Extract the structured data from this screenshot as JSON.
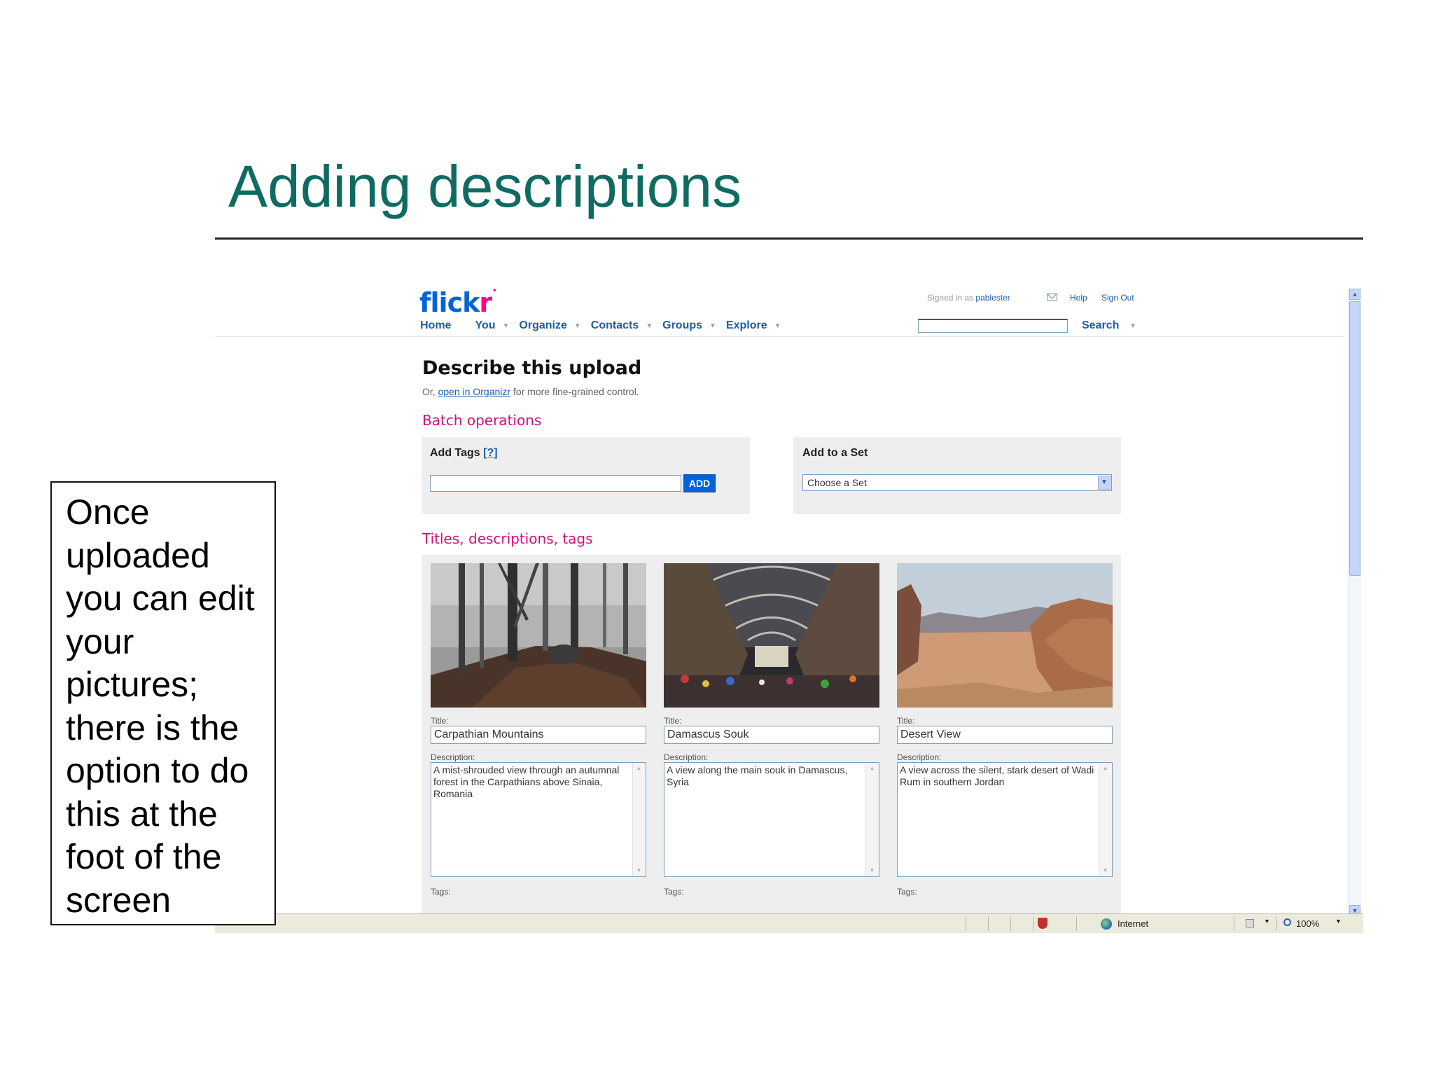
{
  "slide": {
    "title": "Adding descriptions",
    "callout": "Once uploaded you can edit your pictures; there is the option to do this at the foot of the screen"
  },
  "flickr": {
    "logo_part1": "flick",
    "logo_part2": "r",
    "nav": [
      "Home",
      "You",
      "Organize",
      "Contacts",
      "Groups",
      "Explore"
    ],
    "signed_in_prefix": "Signed in as",
    "username": "pablester",
    "help": "Help",
    "sign_out": "Sign Out",
    "search": "Search"
  },
  "page": {
    "heading": "Describe this upload",
    "sub_prefix": "Or,",
    "sub_link": "open in Organizr",
    "sub_suffix": "for more fine-grained control.",
    "batch_heading": "Batch operations",
    "add_tags_label": "Add Tags",
    "add_tags_help": "[?]",
    "add_button": "ADD",
    "add_to_set_label": "Add to a Set",
    "set_select_value": "Choose a Set",
    "titles_heading": "Titles, descriptions, tags",
    "title_label": "Title:",
    "description_label": "Description:",
    "tags_label": "Tags:",
    "photos": [
      {
        "title": "Carpathian Mountains",
        "description": "A mist-shrouded view through an autumnal forest in the Carpathians above Sinaia, Romania"
      },
      {
        "title": "Damascus Souk",
        "description": "A view along the main souk in Damascus, Syria"
      },
      {
        "title": "Desert View",
        "description": "A view across the silent, stark desert of Wadi Rum in southern Jordan"
      }
    ]
  },
  "statusbar": {
    "zone": "Internet",
    "zoom": "100%"
  }
}
